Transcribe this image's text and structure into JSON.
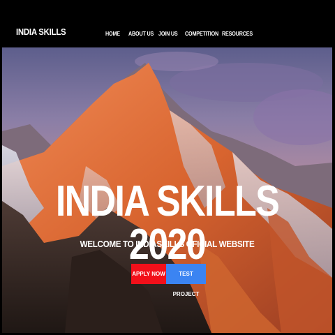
{
  "brand": "INDIA SKILLS",
  "nav": [
    "HOME",
    "ABOUT US",
    "JOIN US",
    "COMPETITION",
    "RESOURCES"
  ],
  "hero": {
    "title": "INDIA SKILLS 2020",
    "subtitle": "WELCOME TO INDIASKILLS OFICIAL WEBSITE",
    "apply_label": "APPLY NOW",
    "test_label": "TEST PROJECT"
  },
  "colors": {
    "navbar_bg": "#000000",
    "apply_button": "#f2101a",
    "test_button": "#3b84f2",
    "text": "#ffffff"
  }
}
